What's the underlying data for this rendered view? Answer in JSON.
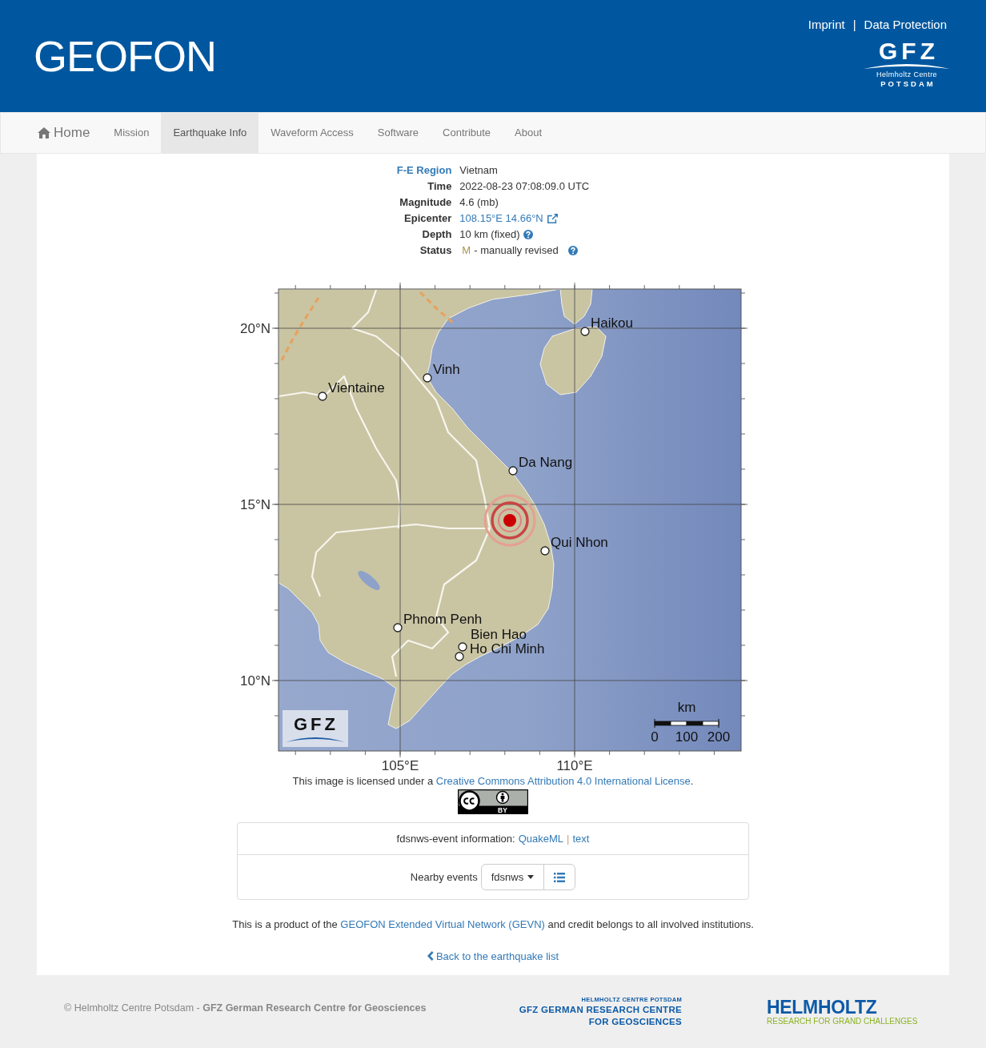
{
  "header": {
    "title": "GEOFON",
    "links": [
      "Imprint",
      "Data Protection"
    ],
    "separator": "|",
    "logo": {
      "mark": "GFZ",
      "subtitle": "Helmholtz Centre",
      "place": "POTSDAM"
    }
  },
  "nav": [
    {
      "label": "Home",
      "kind": "home",
      "selected": false
    },
    {
      "label": "Mission",
      "kind": "page",
      "selected": false
    },
    {
      "label": "Earthquake Info",
      "kind": "page",
      "selected": true
    },
    {
      "label": "Waveform Access",
      "kind": "page",
      "selected": false
    },
    {
      "label": "Software",
      "kind": "page",
      "selected": false
    },
    {
      "label": "Contribute",
      "kind": "page",
      "selected": false
    },
    {
      "label": "About",
      "kind": "page",
      "selected": false
    }
  ],
  "event": [
    {
      "label": "F-E Region",
      "kind": "linked_label",
      "value": "Vietnam"
    },
    {
      "label": "Time",
      "kind": "text",
      "value": "2022-08-23 07:08:09.0 UTC"
    },
    {
      "label": "Magnitude",
      "kind": "text",
      "value": "4.6 (mb)"
    },
    {
      "label": "Epicenter",
      "kind": "external_link",
      "value": "108.15°E 14.66°N"
    },
    {
      "label": "Depth",
      "kind": "help",
      "value": "10 km (fixed)"
    },
    {
      "label": "Status",
      "kind": "status",
      "code": "M",
      "value": "- manually revised"
    }
  ],
  "map": {
    "lat_labels": [
      "20°N",
      "15°N",
      "10°N"
    ],
    "lon_labels": [
      "105°E",
      "110°E"
    ],
    "cities": [
      "Haikou",
      "Vinh",
      "Vientaine",
      "Da Nang",
      "Qui Nhon",
      "Phnom Penh",
      "Bien Hao",
      "Ho Chi Minh"
    ],
    "scale": {
      "unit": "km",
      "labels": [
        "0",
        "100",
        "200"
      ]
    },
    "logo": "GFZ"
  },
  "license": {
    "text": "This image is licensed under a ",
    "link": "Creative Commons Attribution 4.0 International License",
    "end": ".",
    "badge": "BY"
  },
  "services": {
    "label": "fdsnws-event information:",
    "links": [
      "QuakeML",
      "text"
    ],
    "separator": "|",
    "nearby_label": "Nearby events",
    "source": "fdsnws"
  },
  "credit": {
    "text": "This is a product of the ",
    "link": "GEOFON Extended Virtual Network (GEVN)",
    "end": " and credit belongs to all involved institutions."
  },
  "back_link": "Back to the earthquake list",
  "footer": {
    "copyright": "© Helmholtz Centre Potsdam - **GFZ German Research Centre for Geosciences**",
    "gfz_logo": [
      "HELMHOLTZ CENTRE POTSDAM",
      "GFZ GERMAN RESEARCH CENTRE",
      "FOR GEOSCIENCES"
    ],
    "helmholtz_logo": {
      "name": "HELMHOLTZ",
      "tagline": "RESEARCH FOR GRAND CHALLENGES"
    }
  }
}
